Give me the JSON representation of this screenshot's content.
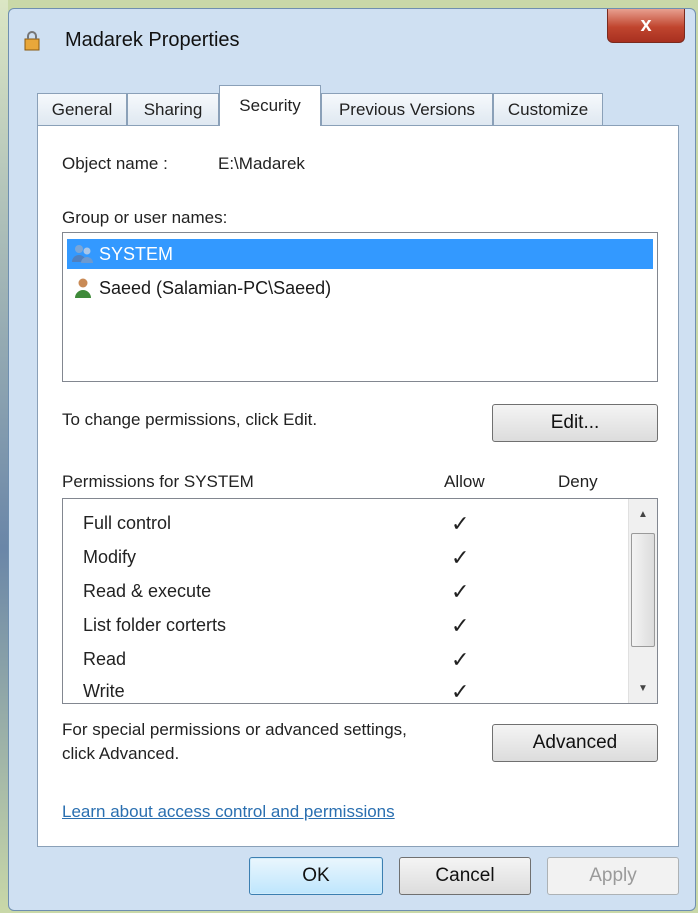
{
  "window": {
    "title": "Madarek Properties",
    "close_label": "x"
  },
  "tabs": [
    {
      "label": "General"
    },
    {
      "label": "Sharing"
    },
    {
      "label": "Security",
      "active": true
    },
    {
      "label": "Previous Versions"
    },
    {
      "label": "Customize"
    }
  ],
  "security": {
    "object_name_label": "Object name :",
    "object_name_value": "E:\\Madarek",
    "group_label": "Group or user names:",
    "users": [
      {
        "name": "SYSTEM",
        "selected": true,
        "icon": "users-group-icon"
      },
      {
        "name": "Saeed (Salamian-PC\\Saeed)",
        "selected": false,
        "icon": "user-icon"
      }
    ],
    "change_text": "To change permissions, click Edit.",
    "edit_button": "Edit...",
    "permissions_label": "Permissions for SYSTEM",
    "allow_header": "Allow",
    "deny_header": "Deny",
    "permissions": [
      {
        "name": "Full control",
        "allow": "✓"
      },
      {
        "name": "Modify",
        "allow": "✓"
      },
      {
        "name": "Read & execute",
        "allow": "✓"
      },
      {
        "name": "List folder corterts",
        "allow": "✓"
      },
      {
        "name": "Read",
        "allow": "✓"
      },
      {
        "name": "Write",
        "allow": "✓"
      }
    ],
    "special_text_line1": "For special permissions or advanced settings,",
    "special_text_line2": "click Advanced.",
    "advanced_button": "Advanced",
    "learn_link": "Learn about access control and permissions"
  },
  "buttons": {
    "ok": "OK",
    "cancel": "Cancel",
    "apply": "Apply"
  },
  "colors": {
    "selection": "#3399ff",
    "link": "#2a6fb0",
    "close_button": "#c0452e"
  }
}
